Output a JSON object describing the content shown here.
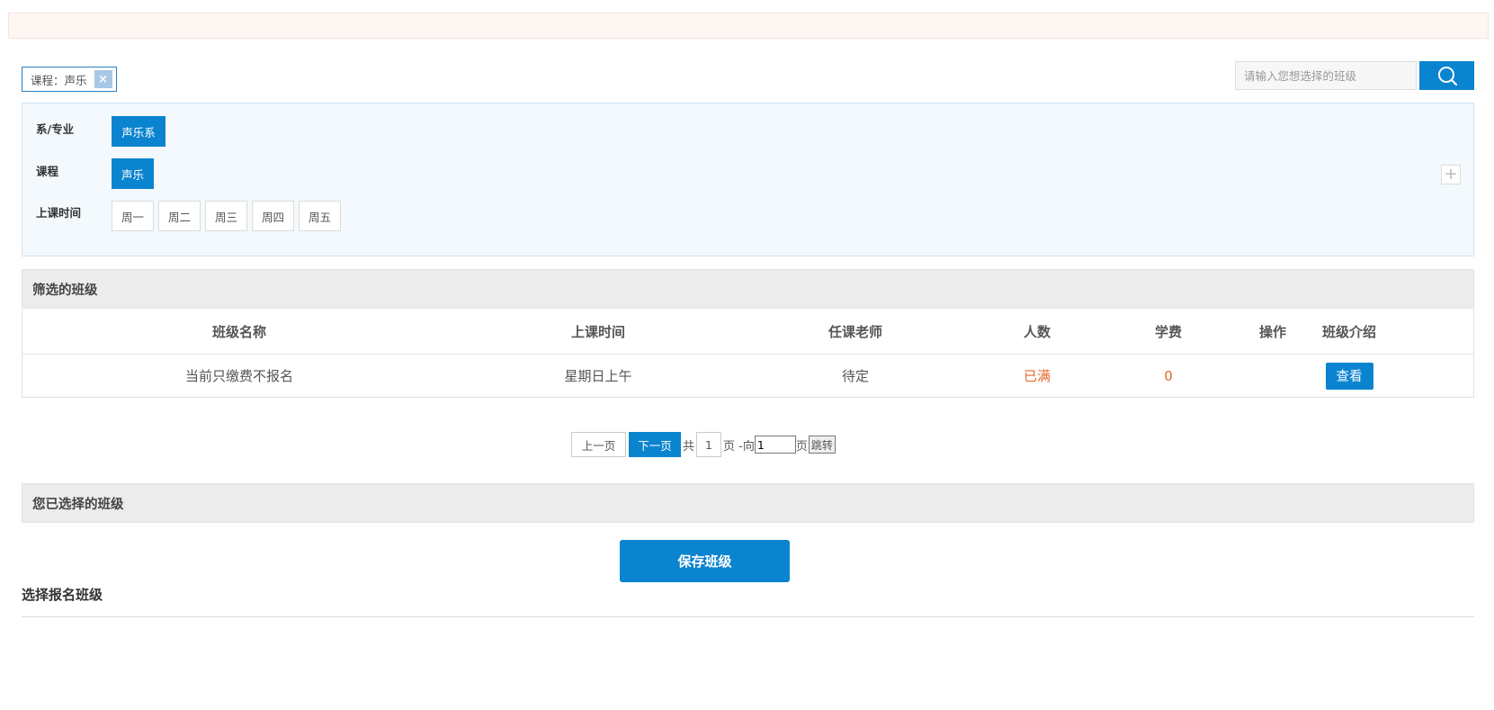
{
  "selected_tag": {
    "label": "课程：声乐",
    "close_glyph": "×"
  },
  "search": {
    "placeholder": "请输入您想选择的班级",
    "icon": "search-icon"
  },
  "filters": {
    "department": {
      "label": "系/专业",
      "options": [
        "声乐系"
      ],
      "selected": "声乐系"
    },
    "course": {
      "label": "课程",
      "options": [
        "声乐"
      ],
      "selected": "声乐"
    },
    "time": {
      "label": "上课时间",
      "options": [
        "周一",
        "周二",
        "周三",
        "周四",
        "周五"
      ]
    },
    "expand_glyph": "+"
  },
  "filtered_section": {
    "title": "筛选的班级"
  },
  "table": {
    "headers": [
      "班级名称",
      "上课时间",
      "任课老师",
      "人数",
      "学费",
      "操作",
      "班级介绍"
    ],
    "rows": [
      {
        "name": "当前只缴费不报名",
        "time": "星期日上午",
        "teacher": "待定",
        "count": "已满",
        "fee": "0",
        "action": "",
        "intro_button": "查看"
      }
    ]
  },
  "pager": {
    "prev": "上一页",
    "next": "下一页",
    "total_prefix": "共",
    "total_pages": "1",
    "goto_prefix": "页 -向",
    "goto_value": "1",
    "goto_suffix": "页",
    "goto_button": "跳转"
  },
  "selected_section": {
    "title": "您已选择的班级"
  },
  "save_button": "保存班级",
  "bottom_title": "选择报名班级",
  "colors": {
    "primary": "#0b84d0",
    "warning": "#e8672a",
    "panel_bg": "#f3f9fd",
    "notice_bg": "#fef6f3"
  }
}
